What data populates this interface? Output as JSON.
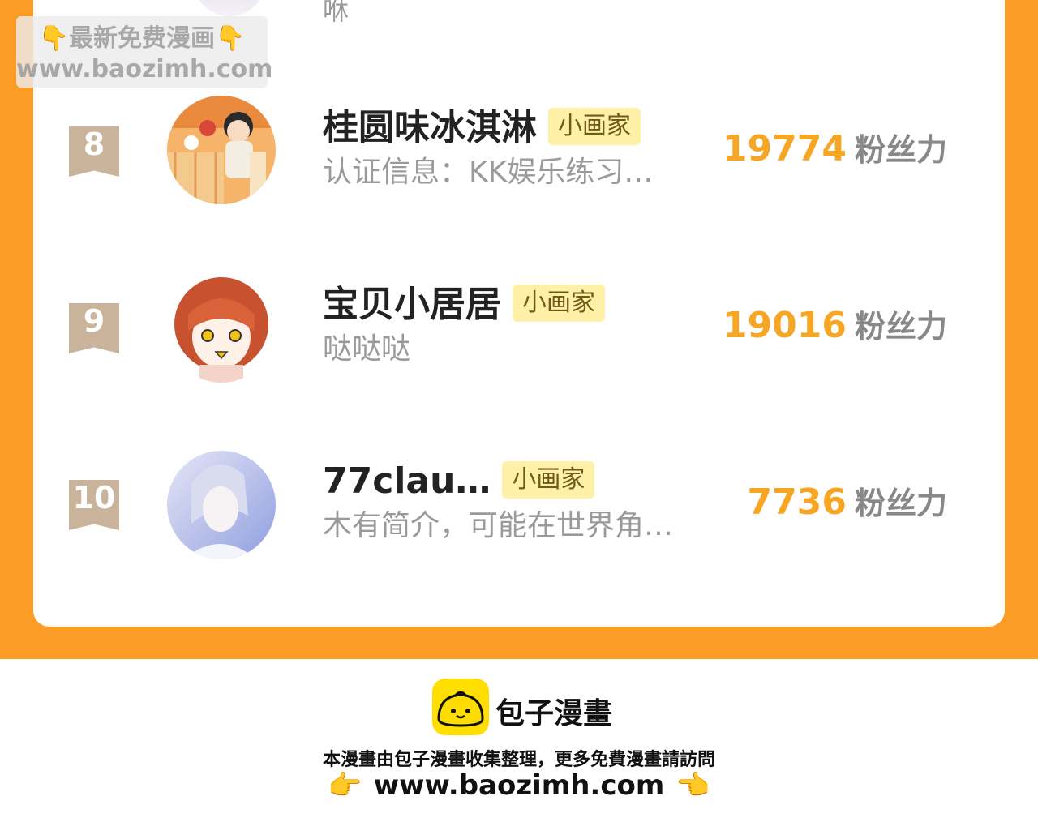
{
  "watermark": {
    "line1": "最新免费漫画",
    "line2": "www.baozimh.com",
    "hand": "👇"
  },
  "prev_row_tail": "咻",
  "entries": [
    {
      "rank": "8",
      "name": "桂圆味冰淇淋",
      "badge": "小画家",
      "desc": "认证信息：KK娱乐练习…",
      "fans": "19774",
      "fans_label": "粉丝力"
    },
    {
      "rank": "9",
      "name": "宝贝小居居",
      "badge": "小画家",
      "desc": "哒哒哒",
      "fans": "19016",
      "fans_label": "粉丝力"
    },
    {
      "rank": "10",
      "name": "77clau…",
      "badge": "小画家",
      "desc": "木有简介，可能在世界角…",
      "fans": "7736",
      "fans_label": "粉丝力"
    }
  ],
  "footer": {
    "logo_text": "包子漫畫",
    "note": "本漫畫由包子漫畫收集整理，更多免費漫畫請訪問",
    "url": "www.baozimh.com",
    "hand_left": "👉",
    "hand_right": "👈"
  },
  "colors": {
    "orange_bg": "#fb9c26",
    "fans_number": "#f6a623",
    "badge_bg": "#fff0a8",
    "rank_ribbon": "#c9b39a",
    "logo_yellow": "#ffde00"
  }
}
